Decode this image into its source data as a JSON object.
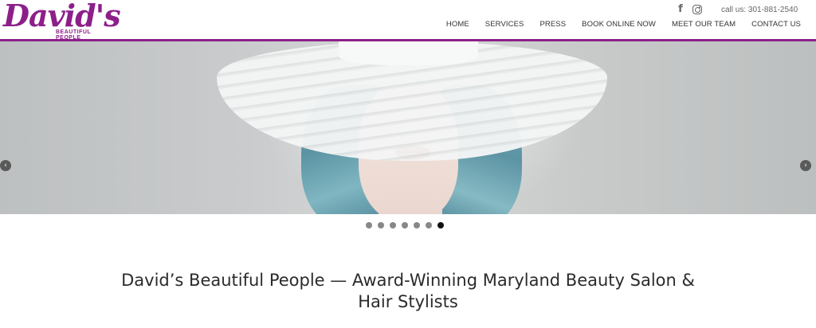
{
  "brand": {
    "logo_script": "David's",
    "logo_sub": "BEAUTIFUL PEOPLE",
    "accent_color": "#8d1f8a"
  },
  "header": {
    "social": [
      {
        "icon": "facebook-icon"
      },
      {
        "icon": "instagram-icon"
      }
    ],
    "phone": "call us: 301-881-2540"
  },
  "nav": {
    "items": [
      {
        "label": "HOME"
      },
      {
        "label": "SERVICES"
      },
      {
        "label": "PRESS"
      },
      {
        "label": "BOOK ONLINE NOW"
      },
      {
        "label": "MEET OUR TEAM"
      },
      {
        "label": "CONTACT US"
      }
    ]
  },
  "slider": {
    "prev_icon": "chevron-left-icon",
    "next_icon": "chevron-right-icon",
    "prev_glyph": "‹",
    "next_glyph": "›",
    "dot_count": 7,
    "active_dot": 7
  },
  "main": {
    "headline_line1": "David’s Beautiful People — Award-Winning Maryland Beauty Salon &",
    "headline_line2": "Hair Stylists"
  }
}
